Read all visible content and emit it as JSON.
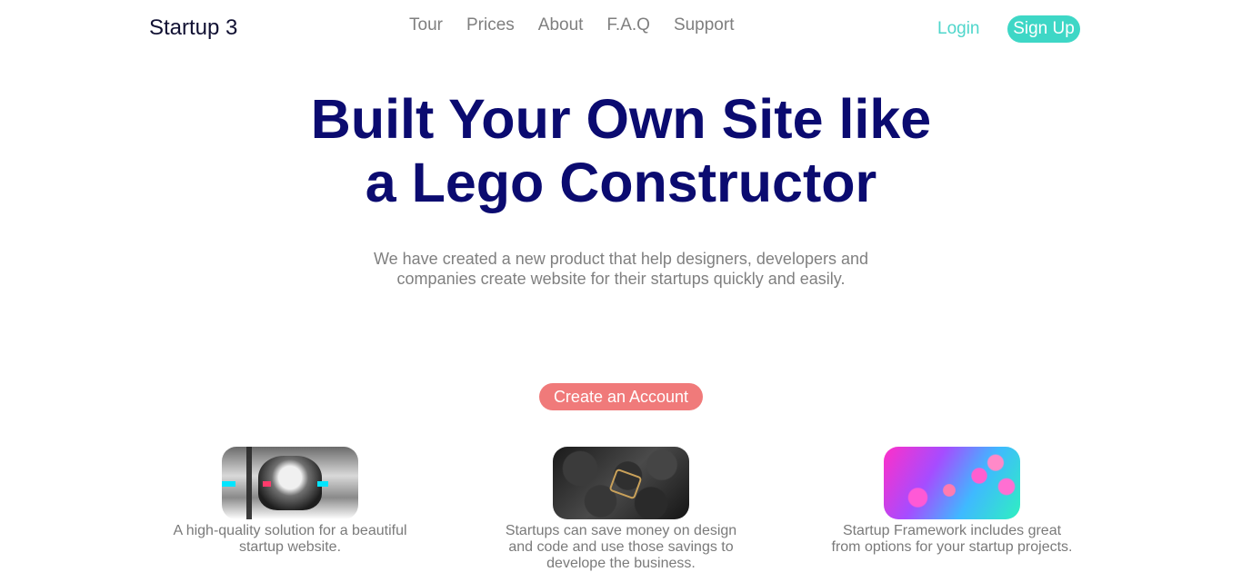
{
  "brand": "Startup 3",
  "nav": [
    "Tour",
    "Prices",
    "About",
    "F.A.Q",
    "Support"
  ],
  "auth": {
    "login": "Login",
    "signup": "Sign Up"
  },
  "hero": {
    "title_line1": "Built Your Own Site like",
    "title_line2": "a Lego Constructor",
    "subtitle": "We have created a new product that help designers, developers and companies create website for their startups quickly and easily.",
    "cta": "Create an Account"
  },
  "features": [
    {
      "caption": "A high-quality solution for a beautiful startup website."
    },
    {
      "caption": "Startups can save money on design and code and use those savings to develope the business."
    },
    {
      "caption": "Startup Framework includes great from options for your startup projects."
    }
  ],
  "colors": {
    "accent": "#3ed7c6",
    "title": "#0b0b70",
    "cta": "#f07a7a"
  }
}
